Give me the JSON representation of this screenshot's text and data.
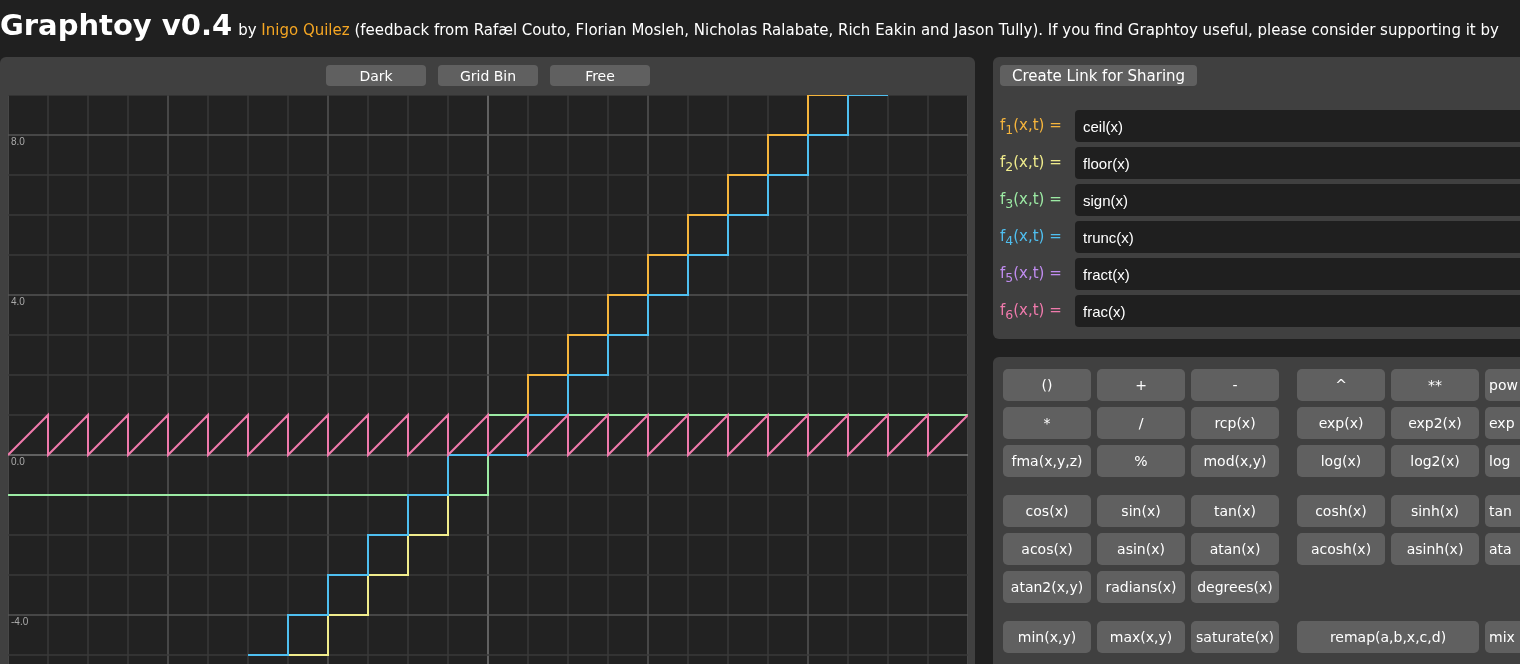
{
  "header": {
    "title": "Graphtoy v0.4",
    "byline_prefix": "by",
    "author_link": "Inigo Quilez",
    "byline_rest": "(feedback from Rafæl Couto, Florian Mosleh, Nicholas Ralabate, Rich Eakin and Jason Tully). If you find Graphtoy useful, please consider supporting it by"
  },
  "graph": {
    "buttons": [
      "Dark",
      "Grid Bin",
      "Free"
    ],
    "y_axis_labels": [
      "8.0",
      "4.0",
      "0.0",
      "-4.0"
    ]
  },
  "share_button": "Create Link for Sharing",
  "functions": [
    {
      "label": "f$_{1}$(x,t) =",
      "color": "#f5b43c",
      "value": "ceil(x)"
    },
    {
      "label": "f$_{2}$(x,t) =",
      "color": "#f0ec8c",
      "value": "floor(x)"
    },
    {
      "label": "f$_{3}$(x,t) =",
      "color": "#9ceaa4",
      "value": "sign(x)"
    },
    {
      "label": "f$_{4}$(x,t) =",
      "color": "#4fbff0",
      "value": "trunc(x)"
    },
    {
      "label": "f$_{5}$(x,t) =",
      "color": "#c08cf0",
      "value": "fract(x)"
    },
    {
      "label": "f$_{6}$(x,t) =",
      "color": "#f07aac",
      "value": "frac(x)"
    }
  ],
  "keypad": [
    [
      {
        "left": [
          "()",
          "+",
          "-"
        ],
        "right": [
          {
            "label": "^",
            "kind": "normal"
          },
          {
            "label": "**",
            "kind": "normal"
          },
          {
            "label": "pow",
            "kind": "cut"
          }
        ]
      },
      {
        "left": [
          "*",
          "/",
          "rcp(x)"
        ],
        "right": [
          {
            "label": "exp(x)",
            "kind": "normal"
          },
          {
            "label": "exp2(x)",
            "kind": "normal"
          },
          {
            "label": "exp",
            "kind": "cut"
          }
        ]
      },
      {
        "left": [
          "fma(x,y,z)",
          "%",
          "mod(x,y)"
        ],
        "right": [
          {
            "label": "log(x)",
            "kind": "normal"
          },
          {
            "label": "log2(x)",
            "kind": "normal"
          },
          {
            "label": "log",
            "kind": "cut"
          }
        ]
      }
    ],
    [
      {
        "left": [
          "cos(x)",
          "sin(x)",
          "tan(x)"
        ],
        "right": [
          {
            "label": "cosh(x)",
            "kind": "normal"
          },
          {
            "label": "sinh(x)",
            "kind": "normal"
          },
          {
            "label": "tan",
            "kind": "cut"
          }
        ]
      },
      {
        "left": [
          "acos(x)",
          "asin(x)",
          "atan(x)"
        ],
        "right": [
          {
            "label": "acosh(x)",
            "kind": "normal"
          },
          {
            "label": "asinh(x)",
            "kind": "normal"
          },
          {
            "label": "ata",
            "kind": "cut"
          }
        ]
      },
      {
        "left": [
          "atan2(x,y)",
          "radians(x)",
          "degrees(x)"
        ]
      }
    ],
    [
      {
        "left": [
          "min(x,y)",
          "max(x,y)",
          "saturate(x)"
        ],
        "right": [
          {
            "label": "remap(a,b,x,c,d)",
            "kind": "wide"
          },
          {
            "label": "mix",
            "kind": "cut"
          }
        ]
      }
    ]
  ]
}
